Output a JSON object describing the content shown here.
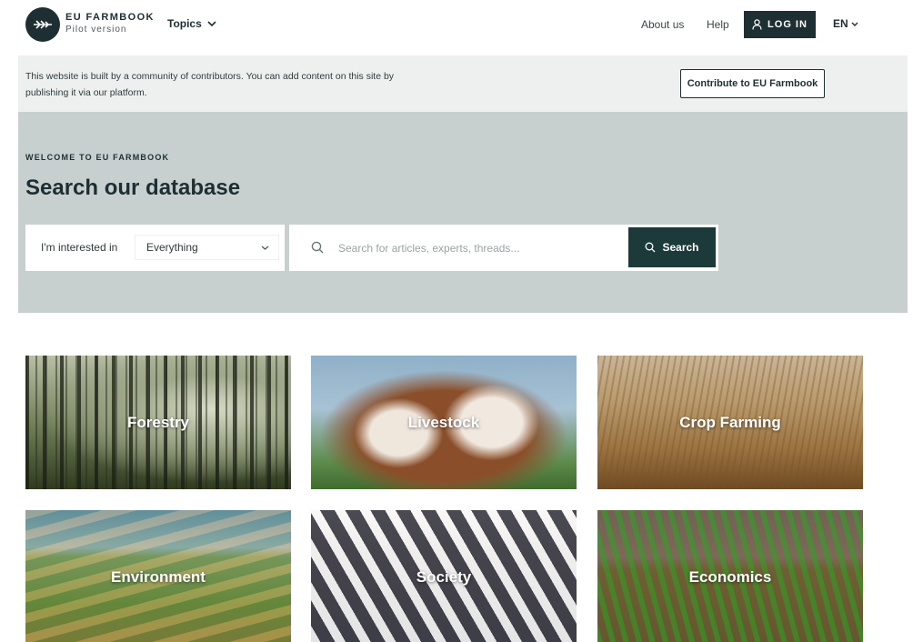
{
  "header": {
    "brand_name": "EU FARMBOOK",
    "brand_sub": "Pilot version",
    "topics_label": "Topics",
    "about_label": "About us",
    "help_label": "Help",
    "login_label": "LOG IN",
    "language": "EN"
  },
  "banner": {
    "text": "This website is built by a community of contributors. You can add content on this site by publishing it via our platform.",
    "button_label": "Contribute to EU Farmbook"
  },
  "hero": {
    "eyebrow": "WELCOME TO EU FARMBOOK",
    "title": "Search our database",
    "interest_label": "I'm interested in",
    "interest_value": "Everything",
    "search_placeholder": "Search for articles, experts, threads...",
    "search_button": "Search"
  },
  "tiles": [
    {
      "label": "Forestry"
    },
    {
      "label": "Livestock"
    },
    {
      "label": "Crop Farming"
    },
    {
      "label": "Environment"
    },
    {
      "label": "Society"
    },
    {
      "label": "Economics"
    }
  ],
  "colors": {
    "brand_dark": "#1d2f32",
    "hero_background": "#c7d0cf",
    "banner_background": "#eef0f0",
    "search_button": "#1d3a3a"
  }
}
